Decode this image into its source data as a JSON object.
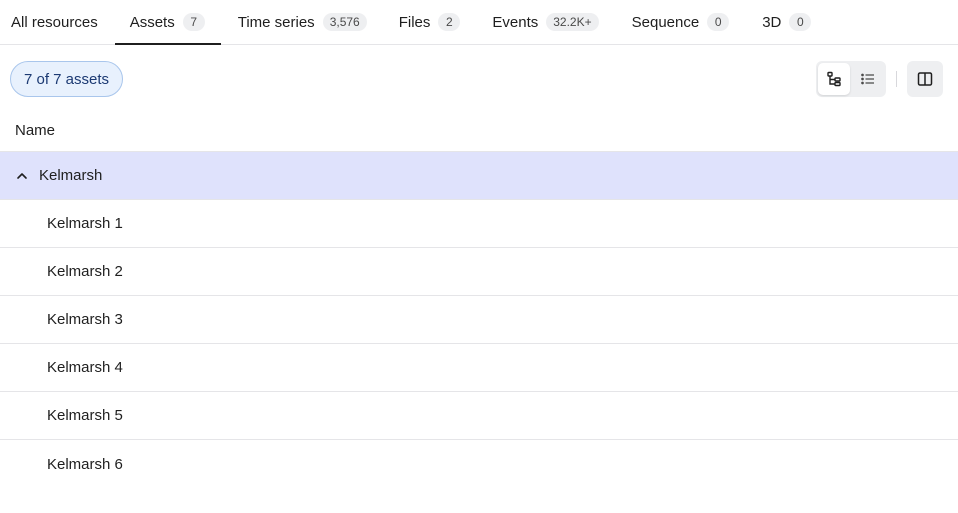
{
  "tabs": [
    {
      "label": "All resources",
      "count": null
    },
    {
      "label": "Assets",
      "count": "7"
    },
    {
      "label": "Time series",
      "count": "3,576"
    },
    {
      "label": "Files",
      "count": "2"
    },
    {
      "label": "Events",
      "count": "32.2K+"
    },
    {
      "label": "Sequence",
      "count": "0"
    },
    {
      "label": "3D",
      "count": "0"
    }
  ],
  "active_tab": "Assets",
  "toolbar": {
    "count_label": "7 of 7 assets",
    "view_toggle": [
      "tree-view-icon",
      "list-view-icon"
    ],
    "active_view": "tree-view-icon",
    "panel_icon": "split-panel-icon"
  },
  "table": {
    "column_header": "Name",
    "parent": {
      "label": "Kelmarsh",
      "expanded": true,
      "icon": "chevron-up-icon"
    },
    "children": [
      "Kelmarsh 1",
      "Kelmarsh 2",
      "Kelmarsh 3",
      "Kelmarsh 4",
      "Kelmarsh 5",
      "Kelmarsh 6"
    ]
  },
  "colors": {
    "selected_row": "#dfe2fc",
    "count_pill_bg": "#e8f1fd",
    "count_pill_border": "#a9c6ec"
  }
}
